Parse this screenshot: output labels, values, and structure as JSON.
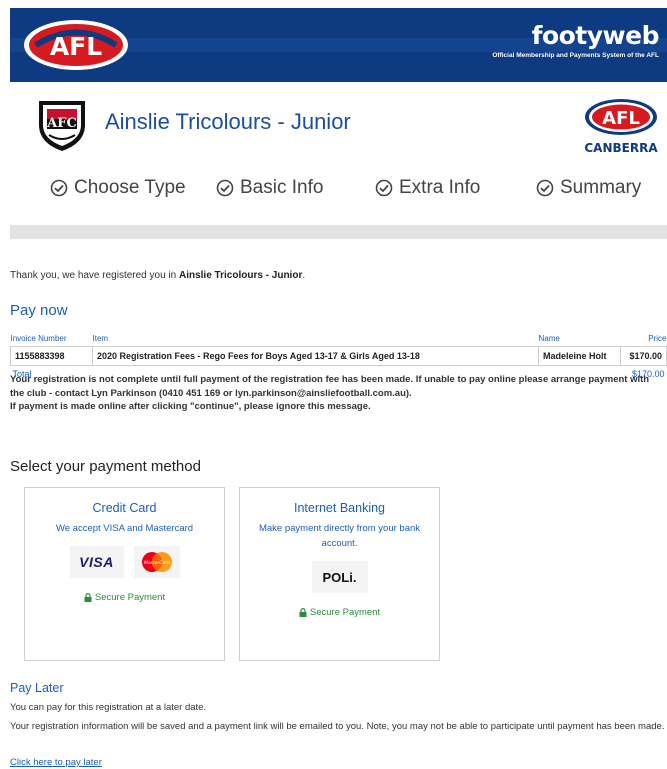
{
  "header": {
    "brand_name": "footyweb",
    "brand_tagline": "Official Membership and Payments System of the AFL",
    "afl_logo_text": "AFL",
    "canberra_text": "CANBERRA"
  },
  "club": {
    "name": "Ainslie Tricolours - Junior",
    "crest_text": "AFC"
  },
  "steps": [
    {
      "label": "Choose Type"
    },
    {
      "label": "Basic Info"
    },
    {
      "label": "Extra Info"
    },
    {
      "label": "Summary"
    }
  ],
  "thanks": {
    "prefix": "Thank you, we have registered you in ",
    "club": "Ainslie Tricolours - Junior",
    "suffix": "."
  },
  "pay_now": {
    "heading": "Pay now",
    "columns": {
      "invoice": "Invoice Number",
      "item": "Item",
      "name": "Name",
      "price": "Price"
    },
    "row": {
      "invoice": "1155883398",
      "item": "2020 Registration Fees - Rego Fees for Boys Aged 13-17 & Girls Aged 13-18",
      "name": "Madeleine Holt",
      "price": "$170.00"
    },
    "total_label": "Total",
    "total_value": "$170.00"
  },
  "notice": {
    "line1": "Your registration is not complete until full payment of the registration fee has been made. If unable to pay online please arrange payment with the club - contact Lyn Parkinson (0410 451 169 or lyn.parkinson@ainsliefootball.com.au).",
    "line2": "If payment is made online after clicking \"continue\", please ignore this message."
  },
  "payment": {
    "heading": "Select your payment method",
    "credit_card": {
      "title": "Credit Card",
      "desc": "We accept VISA and Mastercard",
      "visa": "VISA",
      "mastercard": "MasterCard",
      "secure": "Secure Payment"
    },
    "internet_banking": {
      "title": "Internet Banking",
      "desc": "Make payment directly from your bank account.",
      "poli": "POLi.",
      "secure": "Secure Payment"
    }
  },
  "pay_later": {
    "heading": "Pay Later",
    "line1": "You can pay for this registration at a later date.",
    "line2": "Your registration information will be saved and a payment link will be emailed to you. Note, you may not be able to participate until payment has been made.",
    "link": "Click here to pay later"
  },
  "colors": {
    "banner": "#0d3a80",
    "accent_blue": "#1b5fb5",
    "secure_green": "#2e8b3d"
  }
}
